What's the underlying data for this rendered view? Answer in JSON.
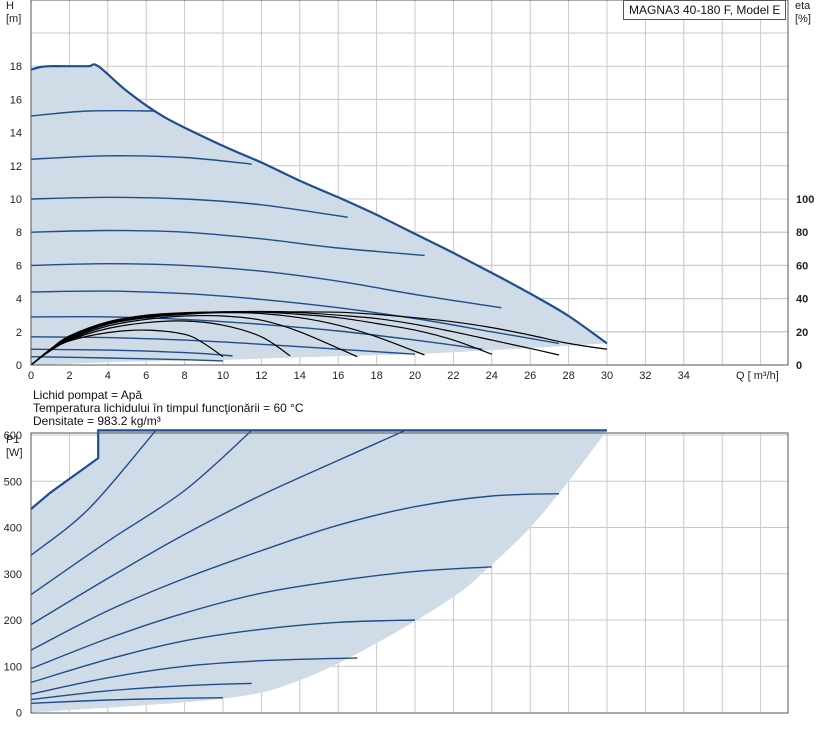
{
  "legend": {
    "title": "MAGNA3 40-180 F, Model E"
  },
  "info": {
    "liquid": "Lichid pompat = Apă",
    "temperature": " Temperatura lichidului în timpul funcţionării = 60 °C",
    "density": "Densitate = 983.2  kg/m³"
  },
  "colors": {
    "curve": "#1f4e8c",
    "fill": "#cfdbe6",
    "eta": "#000000",
    "grid": "#c8c8c8"
  },
  "chart_data": [
    {
      "type": "line",
      "title": "",
      "ylabel": "H",
      "yunit": "[m]",
      "y2label": "eta",
      "y2unit": "[%]",
      "xlabel": "Q [ m³/h]",
      "xlim": [
        0,
        40
      ],
      "ylim": [
        0,
        20
      ],
      "y2lim": [
        0,
        100
      ],
      "x_ticks": [
        0,
        2,
        4,
        6,
        8,
        10,
        12,
        14,
        16,
        18,
        20,
        22,
        24,
        26,
        28,
        30,
        32,
        34
      ],
      "y_ticks": [
        0,
        2,
        4,
        6,
        8,
        10,
        12,
        14,
        16,
        18
      ],
      "y2_ticks": [
        0,
        20,
        40,
        60,
        80,
        100
      ],
      "grid": true,
      "max_curve": [
        [
          0,
          17.8
        ],
        [
          0.5,
          17.95
        ],
        [
          1,
          18
        ],
        [
          2,
          18
        ],
        [
          3,
          18
        ],
        [
          3.5,
          18
        ],
        [
          5,
          16.5
        ],
        [
          7,
          14.9
        ],
        [
          10,
          13.2
        ],
        [
          12,
          12.2
        ],
        [
          14,
          11.1
        ],
        [
          16,
          10.1
        ],
        [
          18,
          9.05
        ],
        [
          20,
          7.9
        ],
        [
          22,
          6.75
        ],
        [
          24,
          5.55
        ],
        [
          26,
          4.3
        ],
        [
          28,
          2.95
        ],
        [
          30,
          1.3
        ]
      ],
      "bottom_boundary": [
        [
          0,
          0
        ],
        [
          5,
          0.2
        ],
        [
          10,
          0.3
        ],
        [
          15,
          0.5
        ],
        [
          20,
          0.65
        ],
        [
          25,
          0.95
        ],
        [
          30,
          1.3
        ]
      ],
      "speed_curves": [
        {
          "points": [
            [
              0,
              15
            ],
            [
              3,
              15.3
            ],
            [
              6.5,
              15.3
            ]
          ]
        },
        {
          "points": [
            [
              0,
              12.4
            ],
            [
              4,
              12.6
            ],
            [
              8,
              12.5
            ],
            [
              11.5,
              12.1
            ]
          ]
        },
        {
          "points": [
            [
              0,
              10
            ],
            [
              4,
              10.1
            ],
            [
              8,
              10
            ],
            [
              12,
              9.65
            ],
            [
              16.5,
              8.9
            ]
          ]
        },
        {
          "points": [
            [
              0,
              8
            ],
            [
              4,
              8.1
            ],
            [
              8,
              8
            ],
            [
              12,
              7.6
            ],
            [
              16,
              7.05
            ],
            [
              20.5,
              6.6
            ]
          ]
        },
        {
          "points": [
            [
              0,
              6
            ],
            [
              4,
              6.1
            ],
            [
              8,
              6
            ],
            [
              12,
              5.65
            ],
            [
              16,
              5.05
            ],
            [
              20,
              4.25
            ],
            [
              24.5,
              3.45
            ]
          ]
        },
        {
          "points": [
            [
              0,
              4.4
            ],
            [
              4,
              4.45
            ],
            [
              8,
              4.3
            ],
            [
              12,
              3.95
            ],
            [
              16,
              3.45
            ],
            [
              20,
              2.8
            ],
            [
              24,
              2
            ],
            [
              27.5,
              1.3
            ]
          ]
        },
        {
          "points": [
            [
              0,
              2.9
            ],
            [
              4,
              2.9
            ],
            [
              8,
              2.75
            ],
            [
              12,
              2.45
            ],
            [
              16,
              2.05
            ],
            [
              20,
              1.5
            ],
            [
              23.5,
              0.95
            ]
          ]
        },
        {
          "points": [
            [
              0,
              1.7
            ],
            [
              4,
              1.65
            ],
            [
              8,
              1.5
            ],
            [
              12,
              1.25
            ],
            [
              16,
              0.95
            ],
            [
              20,
              0.65
            ]
          ]
        },
        {
          "points": [
            [
              0,
              0.95
            ],
            [
              4,
              0.9
            ],
            [
              8,
              0.75
            ],
            [
              10.5,
              0.55
            ]
          ]
        },
        {
          "points": [
            [
              0,
              0.5
            ],
            [
              4,
              0.42
            ],
            [
              8,
              0.32
            ],
            [
              10,
              0.25
            ]
          ]
        }
      ],
      "eta_curves": [
        {
          "points": [
            [
              0,
              0
            ],
            [
              1,
              8.5
            ],
            [
              2,
              14.5
            ],
            [
              4,
              19.5
            ],
            [
              6,
              21
            ],
            [
              8,
              18.5
            ],
            [
              9,
              13
            ],
            [
              10,
              5
            ]
          ]
        },
        {
          "points": [
            [
              0,
              0
            ],
            [
              1,
              8.7
            ],
            [
              2,
              15
            ],
            [
              4,
              22
            ],
            [
              6,
              25.5
            ],
            [
              8,
              26.5
            ],
            [
              10,
              24
            ],
            [
              12,
              17
            ],
            [
              13.5,
              5.5
            ]
          ]
        },
        {
          "points": [
            [
              0,
              0
            ],
            [
              1,
              9
            ],
            [
              2,
              15.5
            ],
            [
              4,
              23.5
            ],
            [
              6,
              27.5
            ],
            [
              8,
              29.5
            ],
            [
              10,
              29.5
            ],
            [
              12,
              27
            ],
            [
              14,
              20
            ],
            [
              17,
              5
            ]
          ]
        },
        {
          "points": [
            [
              0,
              0
            ],
            [
              1,
              9.2
            ],
            [
              2,
              16
            ],
            [
              4,
              24.5
            ],
            [
              6,
              28.5
            ],
            [
              8,
              30.5
            ],
            [
              10,
              31.5
            ],
            [
              12,
              31
            ],
            [
              14,
              28.5
            ],
            [
              16,
              24
            ],
            [
              18,
              17
            ],
            [
              20.5,
              6
            ]
          ]
        },
        {
          "points": [
            [
              0,
              0
            ],
            [
              1,
              9.3
            ],
            [
              2,
              16.5
            ],
            [
              4,
              25
            ],
            [
              6,
              29
            ],
            [
              8,
              31
            ],
            [
              10,
              31.8
            ],
            [
              12,
              31.8
            ],
            [
              14,
              30.5
            ],
            [
              16,
              28.5
            ],
            [
              18,
              25
            ],
            [
              20,
              21
            ],
            [
              22,
              15
            ],
            [
              24,
              6.5
            ]
          ]
        },
        {
          "points": [
            [
              0,
              0
            ],
            [
              1,
              9.4
            ],
            [
              2,
              17
            ],
            [
              4,
              25.5
            ],
            [
              6,
              29.5
            ],
            [
              8,
              31.3
            ],
            [
              10,
              32
            ],
            [
              12,
              32
            ],
            [
              14,
              31.5
            ],
            [
              16,
              30
            ],
            [
              18,
              28
            ],
            [
              20,
              24.5
            ],
            [
              22,
              20
            ],
            [
              24,
              15
            ],
            [
              26,
              10
            ],
            [
              27.5,
              6
            ]
          ]
        },
        {
          "points": [
            [
              0,
              0
            ],
            [
              1,
              9.5
            ],
            [
              2,
              17.5
            ],
            [
              4,
              26
            ],
            [
              6,
              30
            ],
            [
              8,
              31.5
            ],
            [
              10,
              32
            ],
            [
              12,
              32.2
            ],
            [
              14,
              32
            ],
            [
              16,
              31.8
            ],
            [
              18,
              30.5
            ],
            [
              20,
              28.5
            ],
            [
              22,
              26
            ],
            [
              24,
              22.5
            ],
            [
              26,
              18
            ],
            [
              28,
              13
            ],
            [
              30,
              9.5
            ]
          ]
        }
      ]
    },
    {
      "type": "line",
      "title": "",
      "ylabel": "P1",
      "yunit": "[W]",
      "xlim": [
        0,
        40
      ],
      "ylim": [
        0,
        700
      ],
      "y_ticks": [
        0,
        100,
        200,
        300,
        400,
        500,
        600
      ],
      "grid": true,
      "max_curve": [
        [
          0,
          440
        ],
        [
          1,
          475
        ],
        [
          2,
          505
        ],
        [
          3,
          535
        ],
        [
          3.5,
          550
        ],
        [
          3.5,
          610
        ],
        [
          30,
          610
        ]
      ],
      "lower_boundary": [
        [
          0,
          0
        ],
        [
          10,
          30
        ],
        [
          14,
          70
        ],
        [
          18,
          150
        ],
        [
          22,
          250
        ],
        [
          24,
          320
        ],
        [
          26,
          400
        ],
        [
          28,
          500
        ],
        [
          30,
          610
        ]
      ],
      "speed_curves": [
        {
          "points": [
            [
              0,
              340
            ],
            [
              3,
              440
            ],
            [
              6.5,
              610
            ]
          ]
        },
        {
          "points": [
            [
              0,
              255
            ],
            [
              4,
              370
            ],
            [
              8,
              480
            ],
            [
              11.5,
              610
            ]
          ]
        },
        {
          "points": [
            [
              0,
              190
            ],
            [
              4,
              290
            ],
            [
              8,
              385
            ],
            [
              12,
              470
            ],
            [
              16,
              545
            ],
            [
              19.5,
              610
            ]
          ]
        },
        {
          "points": [
            [
              0,
              135
            ],
            [
              4,
              220
            ],
            [
              8,
              290
            ],
            [
              12,
              350
            ],
            [
              16,
              405
            ],
            [
              20,
              445
            ],
            [
              24,
              468
            ],
            [
              27.5,
              473
            ]
          ]
        },
        {
          "points": [
            [
              0,
              95
            ],
            [
              4,
              160
            ],
            [
              8,
              215
            ],
            [
              12,
              258
            ],
            [
              16,
              285
            ],
            [
              20,
              305
            ],
            [
              24,
              315
            ]
          ]
        },
        {
          "points": [
            [
              0,
              65
            ],
            [
              4,
              115
            ],
            [
              8,
              155
            ],
            [
              12,
              180
            ],
            [
              16,
              195
            ],
            [
              20,
              200
            ]
          ]
        },
        {
          "points": [
            [
              0,
              40
            ],
            [
              4,
              75
            ],
            [
              8,
              100
            ],
            [
              12,
              112
            ],
            [
              17,
              118
            ]
          ]
        },
        {
          "points": [
            [
              0,
              28
            ],
            [
              4,
              47
            ],
            [
              8,
              58
            ],
            [
              11.5,
              63
            ]
          ]
        },
        {
          "points": [
            [
              0,
              20
            ],
            [
              4,
              27
            ],
            [
              8,
              31
            ],
            [
              10,
              32
            ]
          ]
        }
      ]
    }
  ]
}
